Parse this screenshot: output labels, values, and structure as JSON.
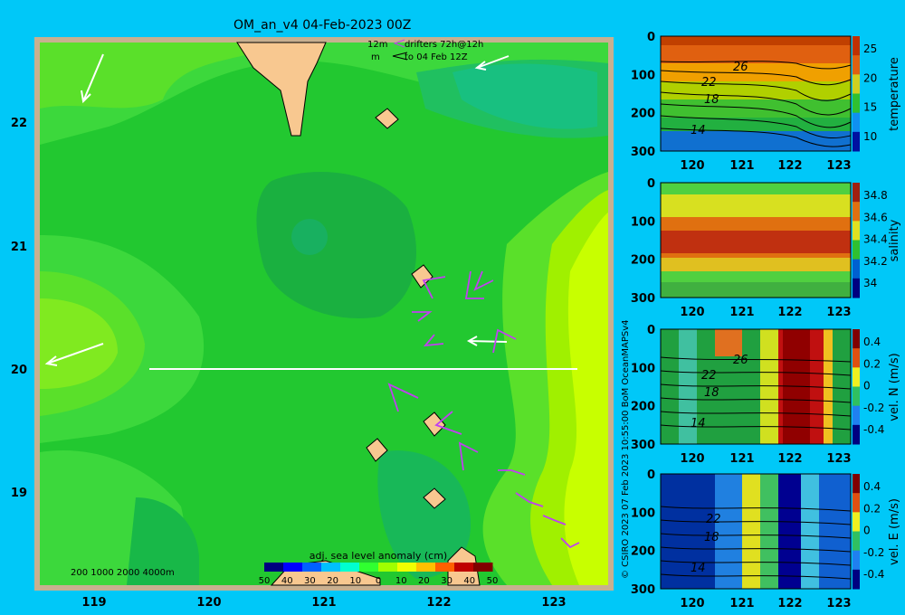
{
  "title": "OM_an_v4  04-Feb-2023 00Z",
  "drifters": {
    "depth": "12m",
    "unit": "m",
    "label": "drifters 72h@12h",
    "target": "to 04 Feb 12Z"
  },
  "map_axes": {
    "x_ticks": [
      "119",
      "120",
      "121",
      "122",
      "123"
    ],
    "y_ticks": [
      "22",
      "21",
      "20",
      "19"
    ]
  },
  "bathy_legend": "200  1000  2000  4000m",
  "colorbar": {
    "title": "adj. sea level anomaly (cm)",
    "labels": [
      "50",
      "40",
      "30",
      "20",
      "10",
      "0",
      "10",
      "20",
      "30",
      "40",
      "50"
    ],
    "colors": [
      "#00007f",
      "#0000ff",
      "#0060ff",
      "#00c0ff",
      "#00ffd0",
      "#30ff30",
      "#a0ff00",
      "#f0ff00",
      "#ffc000",
      "#ff6000",
      "#c00000",
      "#800000"
    ]
  },
  "panels": [
    {
      "name": "temperature",
      "ylabel": "temperature",
      "y_ticks": [
        "0",
        "100",
        "200",
        "300"
      ],
      "x_ticks": [
        "120",
        "121",
        "122",
        "123"
      ],
      "cbar_ticks": [
        "25",
        "20",
        "15",
        "10"
      ],
      "contours": [
        "26",
        "22",
        "18",
        "14"
      ]
    },
    {
      "name": "salinity",
      "ylabel": "salinity",
      "y_ticks": [
        "0",
        "100",
        "200",
        "300"
      ],
      "x_ticks": [
        "120",
        "121",
        "122",
        "123"
      ],
      "cbar_ticks": [
        "34.8",
        "34.6",
        "34.4",
        "34.2",
        "34"
      ],
      "contours": []
    },
    {
      "name": "vel-n",
      "ylabel": "vel. N (m/s)",
      "y_ticks": [
        "0",
        "100",
        "200",
        "300"
      ],
      "x_ticks": [
        "120",
        "121",
        "122",
        "123"
      ],
      "cbar_ticks": [
        "0.4",
        "0.2",
        "0",
        "-0.2",
        "-0.4"
      ],
      "contours": [
        "26",
        "22",
        "18",
        "14"
      ]
    },
    {
      "name": "vel-e",
      "ylabel": "vel. E (m/s)",
      "y_ticks": [
        "0",
        "100",
        "200",
        "300"
      ],
      "x_ticks": [
        "120",
        "121",
        "122",
        "123"
      ],
      "cbar_ticks": [
        "0.4",
        "0.2",
        "0",
        "-0.2",
        "-0.4"
      ],
      "contours": [
        "22",
        "18",
        "14"
      ]
    }
  ],
  "copyright": "© CSIRO 2023   07 Feb 2023 10:55:00 BoM OceanMAPSv4"
}
